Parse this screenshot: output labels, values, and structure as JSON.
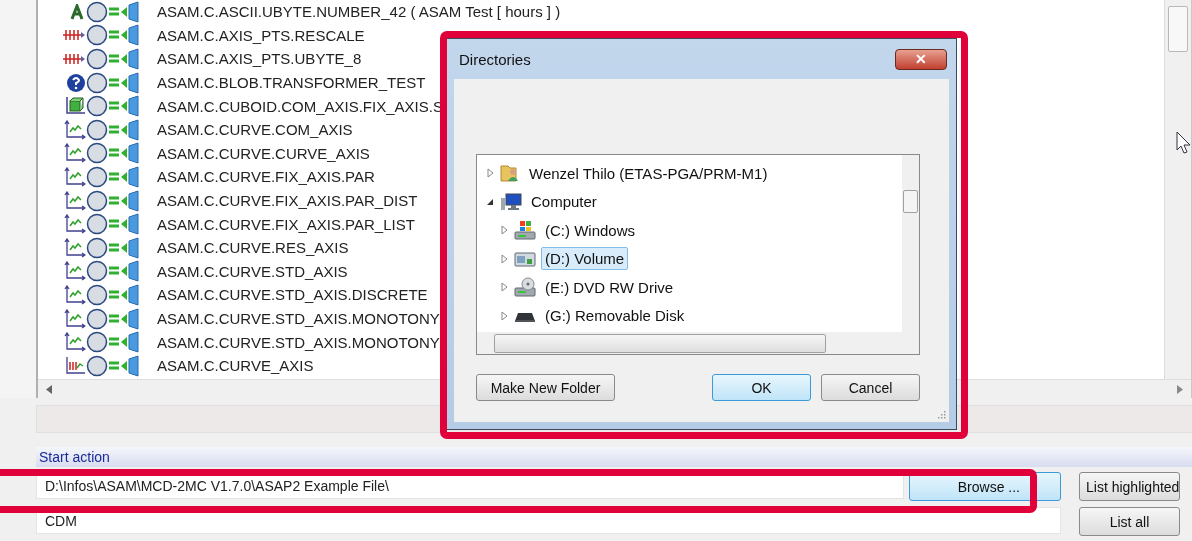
{
  "list": {
    "rows": [
      {
        "kind": "ascii",
        "name": "ASAM.C.ASCII.UBYTE.NUMBER_42 ( ASAM Test [ hours ] )"
      },
      {
        "kind": "axis_pts",
        "name": "ASAM.C.AXIS_PTS.RESCALE"
      },
      {
        "kind": "axis_pts",
        "name": "ASAM.C.AXIS_PTS.UBYTE_8"
      },
      {
        "kind": "blob",
        "name": "ASAM.C.BLOB.TRANSFORMER_TEST"
      },
      {
        "kind": "cuboid",
        "name": "ASAM.C.CUBOID.COM_AXIS.FIX_AXIS.S"
      },
      {
        "kind": "curve",
        "name": "ASAM.C.CURVE.COM_AXIS"
      },
      {
        "kind": "curve",
        "name": "ASAM.C.CURVE.CURVE_AXIS"
      },
      {
        "kind": "curve",
        "name": "ASAM.C.CURVE.FIX_AXIS.PAR"
      },
      {
        "kind": "curve",
        "name": "ASAM.C.CURVE.FIX_AXIS.PAR_DIST"
      },
      {
        "kind": "curve",
        "name": "ASAM.C.CURVE.FIX_AXIS.PAR_LIST"
      },
      {
        "kind": "curve",
        "name": "ASAM.C.CURVE.RES_AXIS"
      },
      {
        "kind": "curve",
        "name": "ASAM.C.CURVE.STD_AXIS"
      },
      {
        "kind": "curve",
        "name": "ASAM.C.CURVE.STD_AXIS.DISCRETE"
      },
      {
        "kind": "curve",
        "name": "ASAM.C.CURVE.STD_AXIS.MONOTONY"
      },
      {
        "kind": "curve",
        "name": "ASAM.C.CURVE.STD_AXIS.MONOTONY"
      },
      {
        "kind": "curve_axis",
        "name": "ASAM.C.CURVE_AXIS"
      }
    ]
  },
  "dialog": {
    "title": "Directories",
    "close": "✕",
    "tree": [
      {
        "label": "Wenzel Thilo (ETAS-PGA/PRM-M1)",
        "kind": "user_folder",
        "expanded": false,
        "selected": false
      },
      {
        "label": "Computer",
        "kind": "computer",
        "expanded": true,
        "selected": false,
        "children": [
          {
            "label": "(C:) Windows",
            "kind": "system_drive",
            "expanded": false,
            "selected": false
          },
          {
            "label": "(D:) Volume",
            "kind": "volume",
            "expanded": false,
            "selected": true
          },
          {
            "label": "(E:) DVD RW Drive",
            "kind": "dvd",
            "expanded": false,
            "selected": false
          },
          {
            "label": "(G:) Removable Disk",
            "kind": "removable",
            "expanded": false,
            "selected": false
          }
        ]
      }
    ],
    "buttons": [
      {
        "label": "Make New Folder",
        "default": false
      },
      {
        "label": "OK",
        "default": true
      },
      {
        "label": "Cancel",
        "default": false
      }
    ]
  },
  "start_action": {
    "heading": "Start action",
    "path": "D:\\Infos\\ASAM\\MCD-2MC V1.7.0\\ASAP2 Example File\\",
    "browse": "Browse ...",
    "list_highlighted": "List highlighted",
    "format": "CDM",
    "list_all": "List all"
  }
}
